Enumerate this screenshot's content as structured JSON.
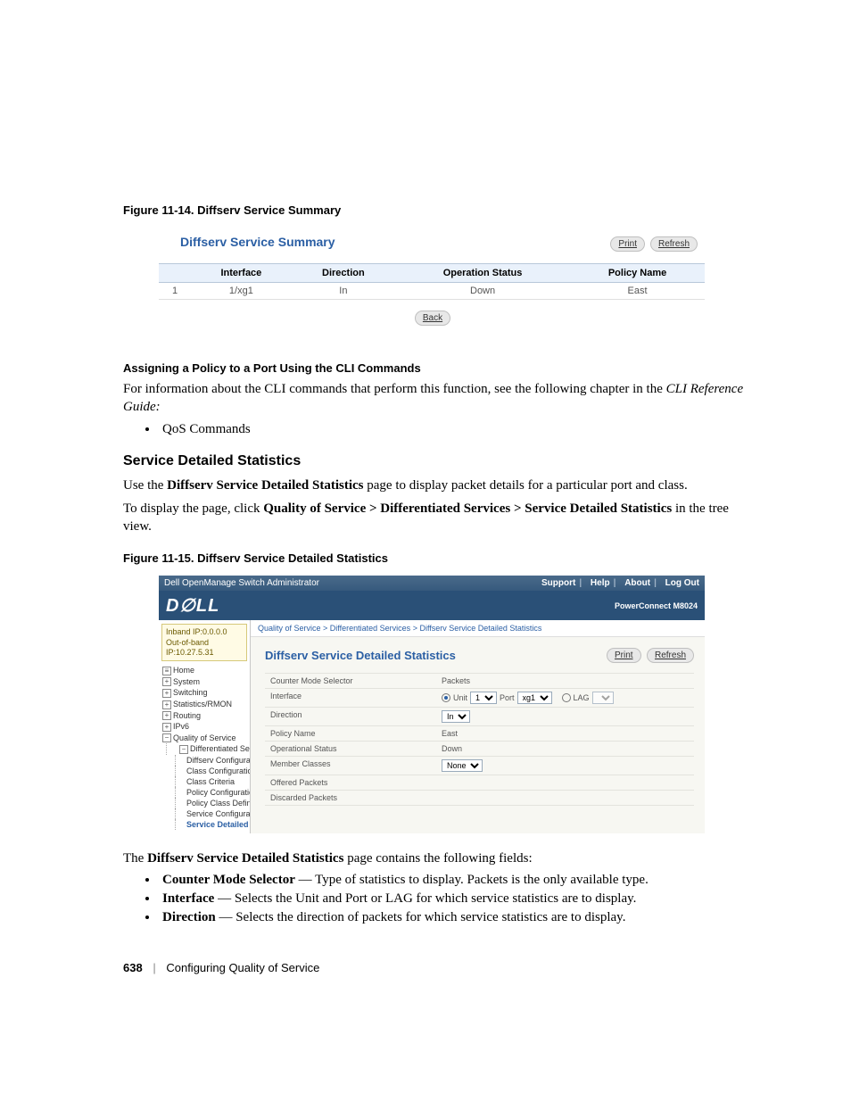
{
  "figure1": {
    "caption": "Figure 11-14.   Diffserv Service Summary",
    "title": "Diffserv Service Summary",
    "buttons": {
      "print": "Print",
      "refresh": "Refresh",
      "back": "Back"
    },
    "columns": [
      "",
      "Interface",
      "Direction",
      "Operation Status",
      "Policy Name"
    ],
    "rows": [
      {
        "n": "1",
        "interface": "1/xg1",
        "direction": "In",
        "status": "Down",
        "policy": "East"
      }
    ]
  },
  "section_cli": {
    "heading": "Assigning a Policy to a Port Using the CLI Commands",
    "para_a": "For information about the CLI commands that perform this function, see the following chapter in the ",
    "para_b": "CLI Reference Guide:",
    "bullet": "QoS Commands"
  },
  "section_stats": {
    "heading": "Service Detailed Statistics",
    "para1_a": "Use the ",
    "para1_b": "Diffserv Service Detailed Statistics",
    "para1_c": " page to display packet details for a particular port and class.",
    "para2_a": "To display the page, click ",
    "para2_b": "Quality of Service > Differentiated Services > Service Detailed Statistics",
    "para2_c": " in the tree view."
  },
  "figure2": {
    "caption": "Figure 11-15.   Diffserv Service Detailed Statistics",
    "topbar": {
      "title": "Dell OpenManage Switch Administrator",
      "links": [
        "Support",
        "Help",
        "About",
        "Log Out"
      ]
    },
    "model": "PowerConnect M8024",
    "ipbox": {
      "l1": "Inband IP:0.0.0.0",
      "l2": "Out-of-band IP:10.27.5.31"
    },
    "tree": {
      "home": "Home",
      "system": "System",
      "switching": "Switching",
      "stats": "Statistics/RMON",
      "routing": "Routing",
      "ipv6": "IPv6",
      "qos": "Quality of Service",
      "diffserv": "Differentiated Services",
      "items": [
        "Diffserv Configuration",
        "Class Configuration",
        "Class Criteria",
        "Policy Configuration",
        "Policy Class Definition",
        "Service Configuration",
        "Service Detailed Stati"
      ]
    },
    "crumb": {
      "a": "Quality of Service",
      "b": "Differentiated Services",
      "c": "Diffserv Service Detailed Statistics"
    },
    "main": {
      "title": "Diffserv Service Detailed Statistics",
      "buttons": {
        "print": "Print",
        "refresh": "Refresh"
      },
      "rows": {
        "counter_mode": {
          "label": "Counter Mode Selector",
          "value": "Packets"
        },
        "interface": {
          "label": "Interface",
          "unit_label": "Unit",
          "unit_val": "1",
          "port_label": "Port",
          "port_val": "xg1",
          "lag_label": "LAG",
          "lag_val": ""
        },
        "direction": {
          "label": "Direction",
          "value": "In"
        },
        "policy_name": {
          "label": "Policy Name",
          "value": "East"
        },
        "op_status": {
          "label": "Operational Status",
          "value": "Down"
        },
        "member": {
          "label": "Member Classes",
          "value": "None"
        },
        "offered": {
          "label": "Offered Packets",
          "value": ""
        },
        "discarded": {
          "label": "Discarded Packets",
          "value": ""
        }
      }
    }
  },
  "fields_intro_a": "The ",
  "fields_intro_b": "Diffserv Service Detailed Statistics",
  "fields_intro_c": " page contains the following fields:",
  "fields": [
    {
      "name": "Counter Mode Selector",
      "desc": " — Type of statistics to display. Packets is the only available type."
    },
    {
      "name": "Interface",
      "desc": " — Selects the Unit and Port or LAG for which service statistics are to display."
    },
    {
      "name": "Direction",
      "desc": " — Selects the direction of packets for which service statistics are to display."
    }
  ],
  "footer": {
    "page": "638",
    "chapter": "Configuring Quality of Service"
  }
}
